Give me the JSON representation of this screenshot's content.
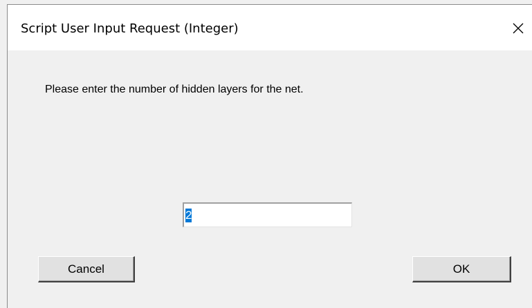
{
  "dialog": {
    "title": "Script User Input Request (Integer)",
    "prompt": "Please enter the number of hidden layers for the net.",
    "input_value": "2",
    "cancel_label": "Cancel",
    "ok_label": "OK",
    "close_icon": "close-icon"
  }
}
